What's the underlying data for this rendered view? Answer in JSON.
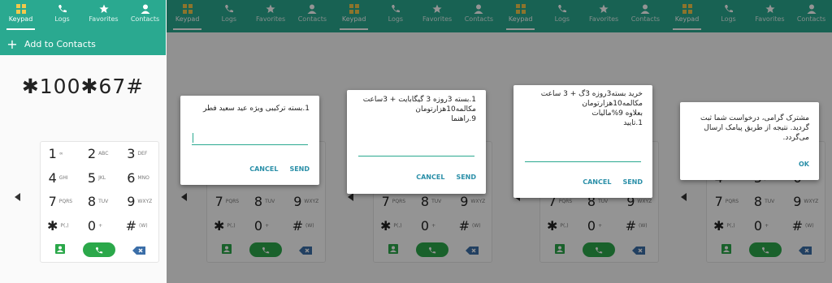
{
  "tabs": [
    {
      "label": "Keypad",
      "icon": "keypad-icon"
    },
    {
      "label": "Logs",
      "icon": "logs-icon"
    },
    {
      "label": "Favorites",
      "icon": "star-icon"
    },
    {
      "label": "Contacts",
      "icon": "person-icon"
    }
  ],
  "add_to_contacts": "Add to Contacts",
  "dialed_number": "✱100✱67#",
  "keys": [
    {
      "d": "1",
      "l": "∞"
    },
    {
      "d": "2",
      "l": "ABC"
    },
    {
      "d": "3",
      "l": "DEF"
    },
    {
      "d": "4",
      "l": "GHI"
    },
    {
      "d": "5",
      "l": "JKL"
    },
    {
      "d": "6",
      "l": "MNO"
    },
    {
      "d": "7",
      "l": "PQRS"
    },
    {
      "d": "8",
      "l": "TUV"
    },
    {
      "d": "9",
      "l": "WXYZ"
    },
    {
      "d": "✱",
      "l": "P(,)"
    },
    {
      "d": "0",
      "l": "+"
    },
    {
      "d": "#",
      "l": "(W)"
    }
  ],
  "dialog1": {
    "line1": "1.بسته ترکیبی ویژه عید سعید فطر",
    "cancel": "CANCEL",
    "send": "SEND"
  },
  "dialog2": {
    "line1": "1.بسته 3روزه 3 گیگابایت + 3ساعت",
    "line2": "مکالمه10هزارتومان",
    "line3": "9.راهنما",
    "cancel": "CANCEL",
    "send": "SEND"
  },
  "dialog3": {
    "line1": "خرید بسته3روزه 3گ + 3 ساعت",
    "line2": "مکالمه10هزارتومان",
    "line3": "بعلاوه 9%مالیات",
    "line4": "1.تایید",
    "cancel": "CANCEL",
    "send": "SEND"
  },
  "dialog4": {
    "line1": "مشترک گرامی، درخواست شما ثبت",
    "line2": "گردید. نتیجه از طریق پیامک ارسال",
    "line3": "می‌گردد.",
    "ok": "OK"
  },
  "colors": {
    "accent": "#2aa990",
    "call": "#2ba84a",
    "dialog_button": "#2a8fa8"
  }
}
